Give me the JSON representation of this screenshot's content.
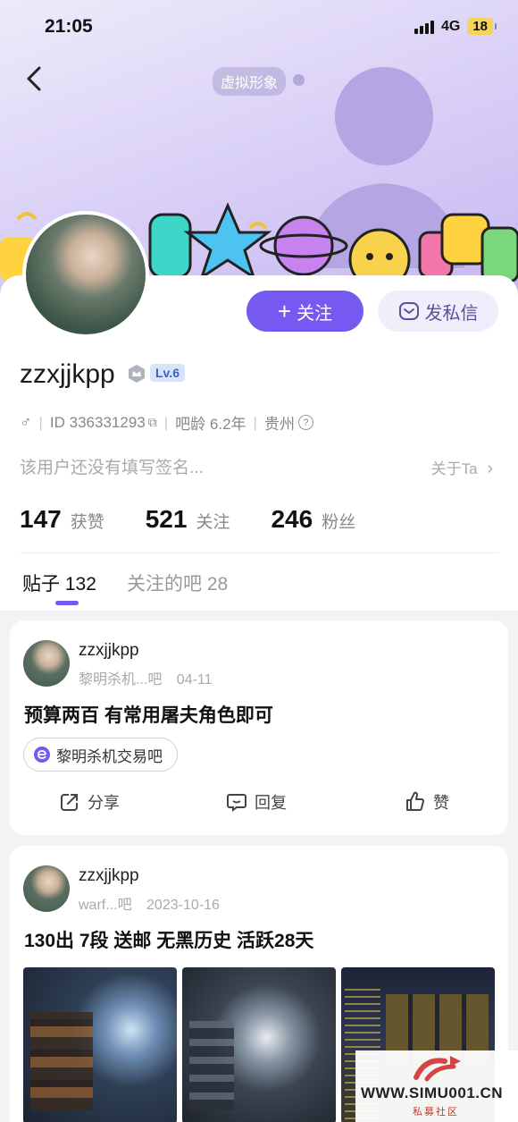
{
  "status": {
    "time": "21:05",
    "network": "4G",
    "battery": "18"
  },
  "header": {
    "virtual_label": "虚拟形象"
  },
  "profile": {
    "follow_label": "关注",
    "dm_label": "发私信",
    "username": "zzxjjkpp",
    "level": "Lv.6",
    "id_text": "ID 336331293",
    "age_text": "吧龄 6.2年",
    "location": "贵州",
    "bio": "该用户还没有填写签名...",
    "about": "关于Ta",
    "stats": [
      {
        "num": "147",
        "label": "获赞"
      },
      {
        "num": "521",
        "label": "关注"
      },
      {
        "num": "246",
        "label": "粉丝"
      }
    ],
    "tabs": [
      {
        "label": "贴子 132"
      },
      {
        "label": "关注的吧 28"
      }
    ]
  },
  "posts": [
    {
      "user": "zzxjjkpp",
      "forum_short": "黎明杀机...吧",
      "date": "04-11",
      "title": "预算两百 有常用屠夫角色即可",
      "forum_tag": "黎明杀机交易吧",
      "actions": {
        "share": "分享",
        "reply": "回复",
        "like": "赞"
      }
    },
    {
      "user": "zzxjjkpp",
      "forum_short": "warf...吧",
      "date": "2023-10-16",
      "title": "130出 7段 送邮 无黑历史 活跃28天"
    }
  ],
  "watermark": {
    "url": "WWW.SIMU001.CN",
    "sub": "私募社区"
  },
  "colors": {
    "accent": "#7559f0",
    "banner": "#dcd3f7"
  }
}
